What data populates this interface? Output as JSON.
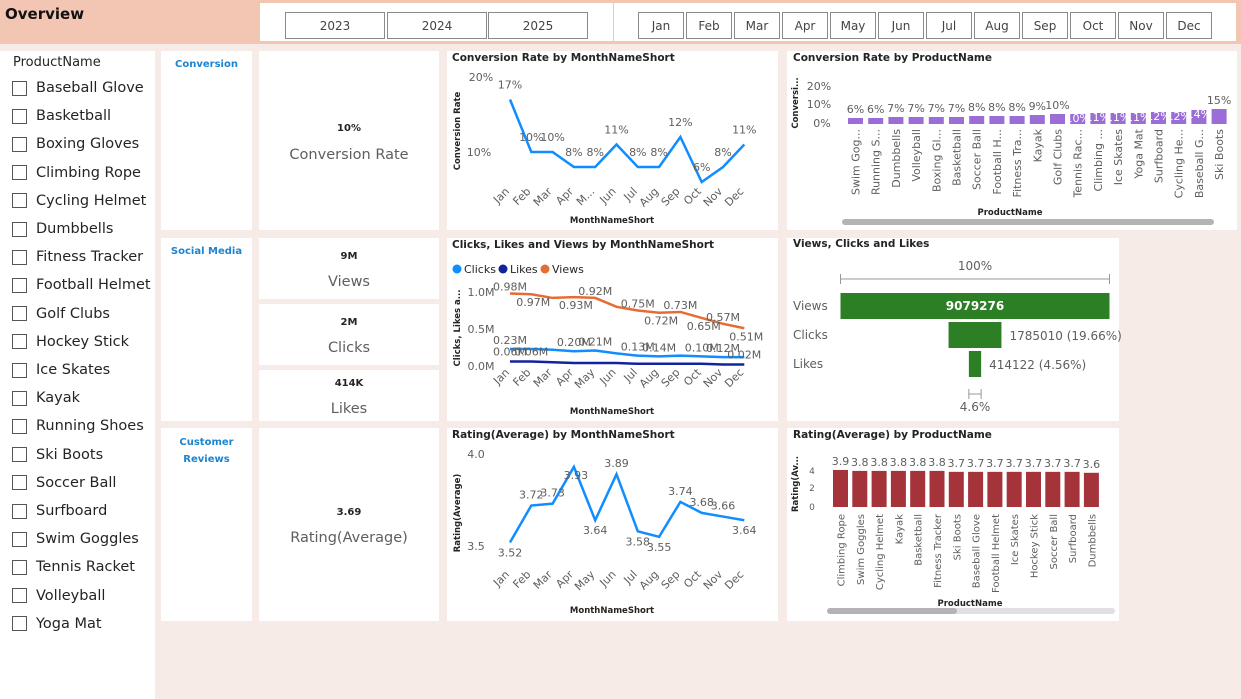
{
  "title": "Overview",
  "years": [
    "2023",
    "2024",
    "2025"
  ],
  "months": [
    "Jan",
    "Feb",
    "Mar",
    "Apr",
    "May",
    "Jun",
    "Jul",
    "Aug",
    "Sep",
    "Oct",
    "Nov",
    "Dec"
  ],
  "product_filter": {
    "title": "ProductName",
    "items": [
      "Baseball Glove",
      "Basketball",
      "Boxing Gloves",
      "Climbing Rope",
      "Cycling Helmet",
      "Dumbbells",
      "Fitness Tracker",
      "Football Helmet",
      "Golf Clubs",
      "Hockey Stick",
      "Ice Skates",
      "Kayak",
      "Running Shoes",
      "Ski Boots",
      "Soccer Ball",
      "Surfboard",
      "Swim Goggles",
      "Tennis Racket",
      "Volleyball",
      "Yoga Mat"
    ]
  },
  "sections": {
    "conversion": "Conversion",
    "social": "Social Media",
    "reviews_l1": "Customer",
    "reviews_l2": "Reviews"
  },
  "kpis": {
    "conversion": {
      "value": "10%",
      "label": "Conversion Rate"
    },
    "views": {
      "value": "9M",
      "label": "Views"
    },
    "clicks": {
      "value": "2M",
      "label": "Clicks"
    },
    "likes": {
      "value": "414K",
      "label": "Likes"
    },
    "rating": {
      "value": "3.69",
      "label": "Rating(Average)"
    }
  },
  "chart_data": [
    {
      "id": "conv_month",
      "type": "line",
      "title": "Conversion Rate by MonthNameShort",
      "xlabel": "MonthNameShort",
      "ylabel": "Conversion Rate",
      "ytick_labels": [
        "20%",
        "10%"
      ],
      "categories": [
        "Jan",
        "Feb",
        "Mar",
        "Apr",
        "M...",
        "Jun",
        "Jul",
        "Aug",
        "Sep",
        "Oct",
        "Nov",
        "Dec"
      ],
      "values": [
        17,
        10,
        10,
        8,
        8,
        11,
        8,
        8,
        12,
        6,
        8,
        11
      ],
      "labels": [
        "17%",
        "10%",
        "10%",
        "8%",
        "8%",
        "11%",
        "8%",
        "8%",
        "12%",
        "6%",
        "8%",
        "11%"
      ],
      "color": "#118dff"
    },
    {
      "id": "conv_product",
      "type": "bar",
      "title": "Conversion Rate by ProductName",
      "xlabel": "ProductName",
      "ylabel": "Conversi...",
      "ytick_labels": [
        "20%",
        "10%",
        "0%"
      ],
      "categories": [
        "Swim Gog...",
        "Running S...",
        "Dumbbells",
        "Volleyball",
        "Boxing Gl...",
        "Basketball",
        "Soccer Ball",
        "Football H...",
        "Fitness Tra...",
        "Kayak",
        "Golf Clubs",
        "Tennis Rac...",
        "Climbing ...",
        "Ice Skates",
        "Yoga Mat",
        "Surfboard",
        "Cycling He...",
        "Baseball G...",
        "Ski Boots"
      ],
      "values": [
        6,
        6,
        7,
        7,
        7,
        7,
        8,
        8,
        8,
        9,
        10,
        10,
        11,
        11,
        11,
        12,
        12,
        14,
        15
      ],
      "labels": [
        "6%",
        "6%",
        "7%",
        "7%",
        "7%",
        "7%",
        "8%",
        "8%",
        "8%",
        "9%",
        "10%",
        "10%",
        "11%",
        "11%",
        "11%",
        "12%",
        "12%",
        "14%",
        "15%"
      ],
      "color": "#9b6dd6"
    },
    {
      "id": "cvl_month",
      "type": "line",
      "title": "Clicks, Likes and Views by MonthNameShort",
      "xlabel": "MonthNameShort",
      "ylabel": "Clicks, Likes a...",
      "ytick_labels": [
        "1.0M",
        "0.5M",
        "0.0M"
      ],
      "categories": [
        "Jan",
        "Feb",
        "Mar",
        "Apr",
        "May",
        "Jun",
        "Jul",
        "Aug",
        "Sep",
        "Oct",
        "Nov",
        "Dec"
      ],
      "series": [
        {
          "name": "Clicks",
          "color": "#118dff",
          "values": [
            0.23,
            0.23,
            0.22,
            0.2,
            0.21,
            0.17,
            0.14,
            0.13,
            0.14,
            0.13,
            0.12,
            0.12
          ],
          "labels": [
            "0.23M",
            "",
            "",
            "0.20M",
            "0.21M",
            "",
            "0.13M",
            "0.14M",
            "",
            "0.10M",
            "0.12M",
            ""
          ]
        },
        {
          "name": "Likes",
          "color": "#12239e",
          "values": [
            0.06,
            0.06,
            0.05,
            0.04,
            0.04,
            0.04,
            0.03,
            0.03,
            0.03,
            0.03,
            0.02,
            0.02
          ],
          "labels": [
            "0.06M",
            "0.06M",
            "",
            "",
            "",
            "",
            "",
            "",
            "",
            "",
            "",
            "0.02M"
          ]
        },
        {
          "name": "Views",
          "color": "#e66c37",
          "values": [
            0.98,
            0.97,
            0.92,
            0.93,
            0.92,
            0.8,
            0.75,
            0.72,
            0.73,
            0.65,
            0.57,
            0.51
          ],
          "labels": [
            "0.98M",
            "0.97M",
            "",
            "0.93M",
            "0.92M",
            "",
            "0.75M",
            "0.72M",
            "0.73M",
            "0.65M",
            "0.57M",
            "0.51M"
          ]
        }
      ]
    },
    {
      "id": "funnel",
      "type": "bar",
      "title": "Views, Clicks and Likes",
      "categories": [
        "Views",
        "Clicks",
        "Likes"
      ],
      "values": [
        9079276,
        1785010,
        414122
      ],
      "labels": [
        "9079276",
        "1785010 (19.66%)",
        "414122 (4.56%)"
      ],
      "top_label": "100%",
      "bottom_label": "4.6%",
      "color": "#2c7f24"
    },
    {
      "id": "rating_month",
      "type": "line",
      "title": "Rating(Average) by MonthNameShort",
      "xlabel": "MonthNameShort",
      "ylabel": "Rating(Average)",
      "ytick_labels": [
        "4.0",
        "3.5"
      ],
      "categories": [
        "Jan",
        "Feb",
        "Mar",
        "Apr",
        "May",
        "Jun",
        "Jul",
        "Aug",
        "Sep",
        "Oct",
        "Nov",
        "Dec"
      ],
      "values": [
        3.52,
        3.72,
        3.73,
        3.93,
        3.64,
        3.89,
        3.58,
        3.55,
        3.74,
        3.68,
        3.66,
        3.64
      ],
      "labels": [
        "3.52",
        "3.72",
        "3.73",
        "3.93",
        "3.64",
        "3.89",
        "3.58",
        "3.55",
        "3.74",
        "3.68",
        "3.66",
        "3.64"
      ],
      "color": "#118dff"
    },
    {
      "id": "rating_product",
      "type": "bar",
      "title": "Rating(Average) by ProductName",
      "xlabel": "ProductName",
      "ylabel": "Rating(Av...",
      "ytick_labels": [
        "4",
        "2",
        "0"
      ],
      "categories": [
        "Climbing Rope",
        "Swim Goggles",
        "Cycling Helmet",
        "Kayak",
        "Basketball",
        "Fitness Tracker",
        "Ski Boots",
        "Baseball Glove",
        "Football Helmet",
        "Ice Skates",
        "Hockey Stick",
        "Soccer Ball",
        "Surfboard",
        "Dumbbells"
      ],
      "values": [
        3.9,
        3.8,
        3.8,
        3.8,
        3.8,
        3.8,
        3.7,
        3.7,
        3.7,
        3.7,
        3.7,
        3.7,
        3.7,
        3.6
      ],
      "labels": [
        "3.9",
        "3.8",
        "3.8",
        "3.8",
        "3.8",
        "3.8",
        "3.7",
        "3.7",
        "3.7",
        "3.7",
        "3.7",
        "3.7",
        "3.7",
        "3.6"
      ],
      "color": "#a4343a"
    }
  ]
}
